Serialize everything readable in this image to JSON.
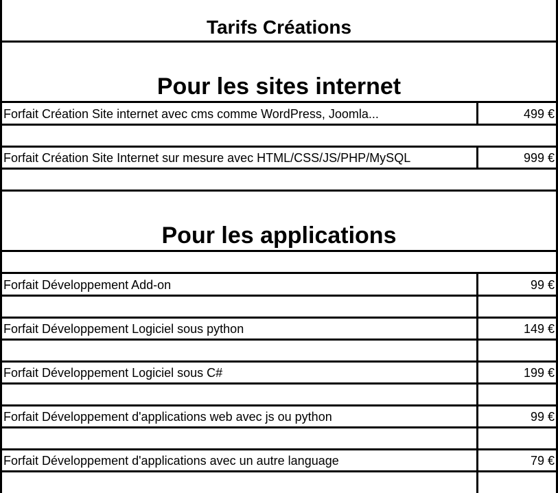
{
  "sheet": {
    "title": "Tarifs Créations",
    "sections": [
      {
        "heading": "Pour les sites internet",
        "rows": [
          {
            "label": "Forfait Création Site internet avec cms comme WordPress, Joomla...",
            "price": "499 €"
          },
          {
            "label": "Forfait Création Site Internet sur mesure avec HTML/CSS/JS/PHP/MySQL",
            "price": "999 €"
          }
        ]
      },
      {
        "heading": "Pour les applications",
        "rows": [
          {
            "label": "Forfait Développement Add-on",
            "price": "99 €"
          },
          {
            "label": "Forfait Développement Logiciel sous python",
            "price": "149 €"
          },
          {
            "label": "Forfait Développement Logiciel sous C#",
            "price": "199 €"
          },
          {
            "label": "Forfait Développement d'applications web avec js ou python",
            "price": "99 €"
          },
          {
            "label": "Forfait Développement d'applications avec un autre language",
            "price": "79 €"
          }
        ]
      }
    ]
  }
}
